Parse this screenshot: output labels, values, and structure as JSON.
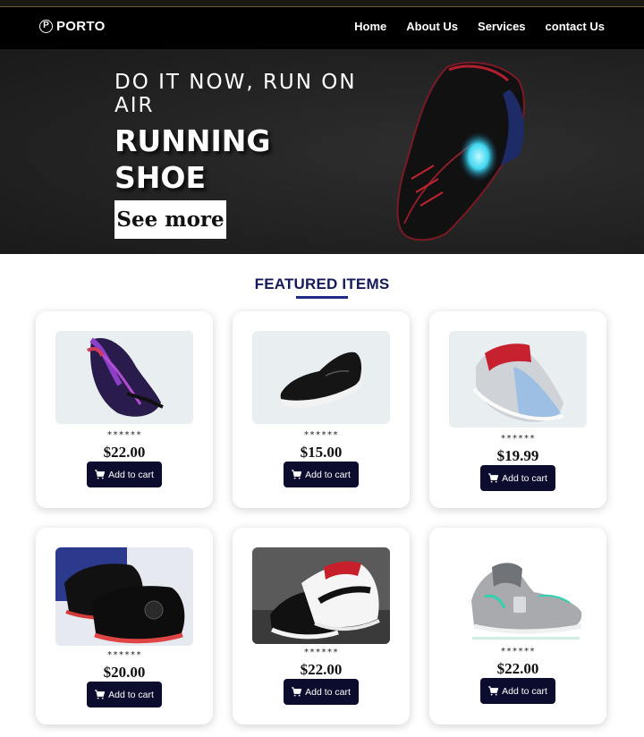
{
  "nav": {
    "logo_mark": "P",
    "logo_text": "PORTO",
    "links": [
      "Home",
      "About Us",
      "Services",
      "contact Us"
    ]
  },
  "hero": {
    "subtitle": "DO IT NOW, RUN ON AIR",
    "title": "RUNNING SHOE",
    "cta": "See more"
  },
  "featured": {
    "heading": "FEATURED ITEMS",
    "items": [
      {
        "image": "purple-running-shoe",
        "rating": "******",
        "price": "$22.00",
        "cart_label": "Add to cart"
      },
      {
        "image": "black-sneaker",
        "rating": "******",
        "price": "$15.00",
        "cart_label": "Add to cart"
      },
      {
        "image": "jordan-grey-red-sneakers",
        "rating": "******",
        "price": "$19.99",
        "cart_label": "Add to cart"
      },
      {
        "image": "black-red-high-tops",
        "rating": "******",
        "price": "$20.00",
        "cart_label": "Add to cart"
      },
      {
        "image": "black-white-red-sneakers",
        "rating": "******",
        "price": "$22.00",
        "cart_label": "Add to cart"
      },
      {
        "image": "grey-mint-jordan",
        "rating": "******",
        "price": "$22.00",
        "cart_label": "Add to cart"
      }
    ]
  },
  "colors": {
    "nav_bg": "#000000",
    "hero_bg": "#232323",
    "heading": "#141a5a",
    "cart_button": "#0c0c2e"
  }
}
